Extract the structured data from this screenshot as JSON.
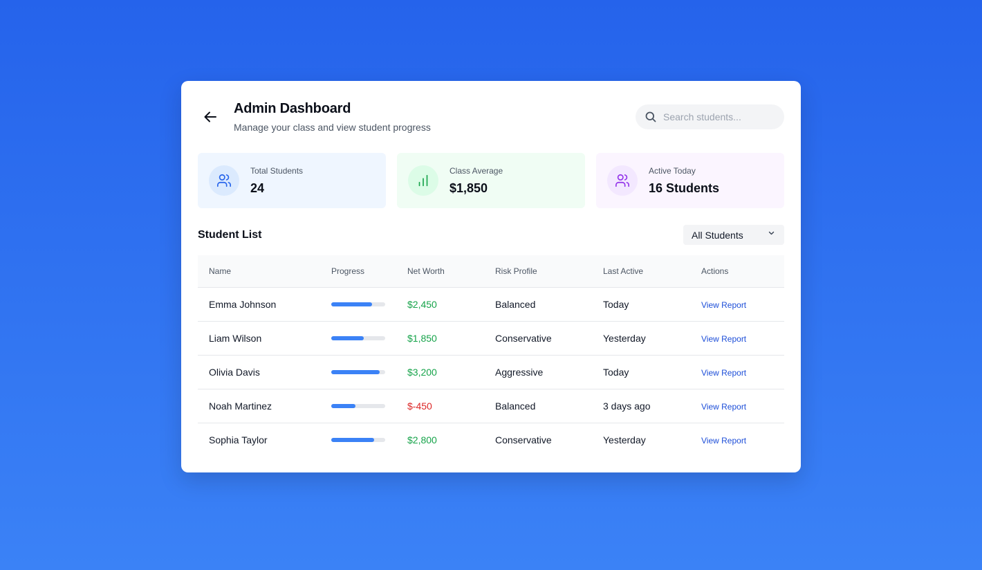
{
  "header": {
    "title": "Admin Dashboard",
    "subtitle": "Manage your class and view student progress",
    "back_icon": "arrow-left-icon"
  },
  "search": {
    "placeholder": "Search students...",
    "value": "",
    "icon": "search-icon"
  },
  "stats": [
    {
      "label": "Total Students",
      "value": "24",
      "icon": "users-icon",
      "accent": "#2563eb"
    },
    {
      "label": "Class Average",
      "value": "$1,850",
      "icon": "bar-chart-icon",
      "accent": "#16a34a"
    },
    {
      "label": "Active Today",
      "value": "16 Students",
      "icon": "users-icon",
      "accent": "#9333ea"
    }
  ],
  "student_list": {
    "title": "Student List",
    "filter": {
      "selected": "All Students",
      "icon": "chevron-down-icon"
    },
    "columns": [
      "Name",
      "Progress",
      "Net Worth",
      "Risk Profile",
      "Last Active",
      "Actions"
    ],
    "rows": [
      {
        "name": "Emma Johnson",
        "progress": 0.75,
        "net_worth": "$2,450",
        "negative": false,
        "risk": "Balanced",
        "last_active": "Today",
        "action": "View Report"
      },
      {
        "name": "Liam Wilson",
        "progress": 0.6,
        "net_worth": "$1,850",
        "negative": false,
        "risk": "Conservative",
        "last_active": "Yesterday",
        "action": "View Report"
      },
      {
        "name": "Olivia Davis",
        "progress": 0.9,
        "net_worth": "$3,200",
        "negative": false,
        "risk": "Aggressive",
        "last_active": "Today",
        "action": "View Report"
      },
      {
        "name": "Noah Martinez",
        "progress": 0.45,
        "net_worth": "$-450",
        "negative": true,
        "risk": "Balanced",
        "last_active": "3 days ago",
        "action": "View Report"
      },
      {
        "name": "Sophia Taylor",
        "progress": 0.8,
        "net_worth": "$2,800",
        "negative": false,
        "risk": "Conservative",
        "last_active": "Yesterday",
        "action": "View Report"
      }
    ]
  },
  "colors": {
    "background_top": "#2563eb",
    "background_bottom": "#3b82f6",
    "progress_fill": "#3b82f6",
    "positive": "#16a34a",
    "negative": "#dc2626",
    "link": "#1d4ed8"
  }
}
